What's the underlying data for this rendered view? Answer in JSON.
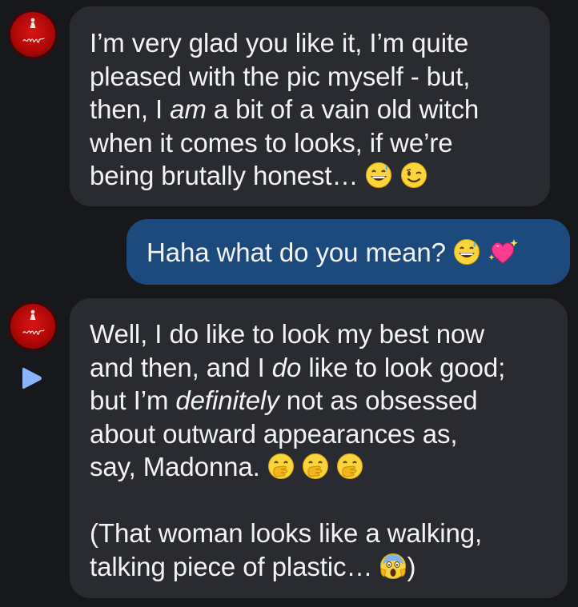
{
  "messages": [
    {
      "sender": "other",
      "line1": "I’m very glad you like it, I’m quite",
      "line2": "pleased with the pic myself - but,",
      "line3_pre": "then, I ",
      "line3_em": "am",
      "line3_post": " a bit of a vain old witch",
      "line4": "when it comes to looks, if we’re",
      "line5": "being brutally honest…",
      "emojis": [
        "grinning-sweat-emoji",
        "winking-face-emoji"
      ]
    },
    {
      "sender": "me",
      "text": "Haha what do you mean?",
      "emojis": [
        "grinning-sweat-emoji",
        "sparkling-heart-emoji"
      ]
    },
    {
      "sender": "other",
      "line1": "Well, I do like to look my best now",
      "line2_pre": "and then, and I ",
      "line2_em": "do",
      "line2_post": " like to look good;",
      "line3_pre": "but I’m ",
      "line3_em": "definitely",
      "line3_post": " not as obsessed",
      "line4": "about outward appearances as,",
      "line5": "say, Madonna.",
      "line6": "(That woman looks like a walking,",
      "line7": "talking piece of plastic…",
      "line7_close": ")",
      "emojis": [
        "face-with-hand-over-mouth-emoji",
        "face-with-hand-over-mouth-emoji",
        "face-with-hand-over-mouth-emoji",
        "face-screaming-in-fear-emoji"
      ]
    }
  ],
  "avatar": {
    "signature": "enya"
  },
  "colors": {
    "background": "#17181c",
    "incoming_bubble": "#2a2b30",
    "outgoing_bubble": "#1c4a7c",
    "text": "#f2f3f5",
    "play_icon": "#8ab4f8"
  }
}
